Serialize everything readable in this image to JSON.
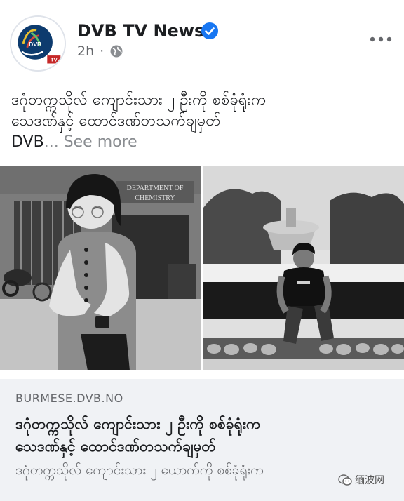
{
  "post": {
    "page_name": "DVB TV News",
    "time": "2h",
    "separator": "·",
    "avatar_text": "DVB",
    "avatar_badge": "TV",
    "caption_lines": [
      "ဒဂုံတက္ကသိုလ် ကျောင်းသား ၂ ဦးကို စစ်ခုံရုံးက",
      "သေဒဏ်နှင့် ထောင်ဒဏ်တသက်ချမှတ်"
    ],
    "caption_tail": "DVB",
    "see_more": "... See more"
  },
  "photos": {
    "left_sign_line1": "DEPARTMENT OF",
    "left_sign_line2": "CHEMISTRY"
  },
  "link_preview": {
    "domain": "BURMESE.DVB.NO",
    "title_lines": [
      "ဒဂုံတက္ကသိုလ် ကျောင်းသား ၂ ဦးကို စစ်ခုံရုံးက",
      "သေဒဏ်နှင့် ထောင်ဒဏ်တသက်ချမှတ်"
    ],
    "description": "ဒဂုံတက္ကသိုလ် ကျောင်းသား ၂ ယောက်ကို စစ်ခုံရုံးက"
  },
  "watermark": {
    "text": "缅波网"
  },
  "colors": {
    "verified": "#1877f2",
    "secondary_text": "#65676b",
    "see_more": "#8a8d91",
    "preview_bg": "#f0f2f5"
  },
  "icons": {
    "verified": "verified-badge-icon",
    "audience": "globe-icon",
    "menu": "more-options-icon",
    "watermark": "wechat-icon"
  }
}
